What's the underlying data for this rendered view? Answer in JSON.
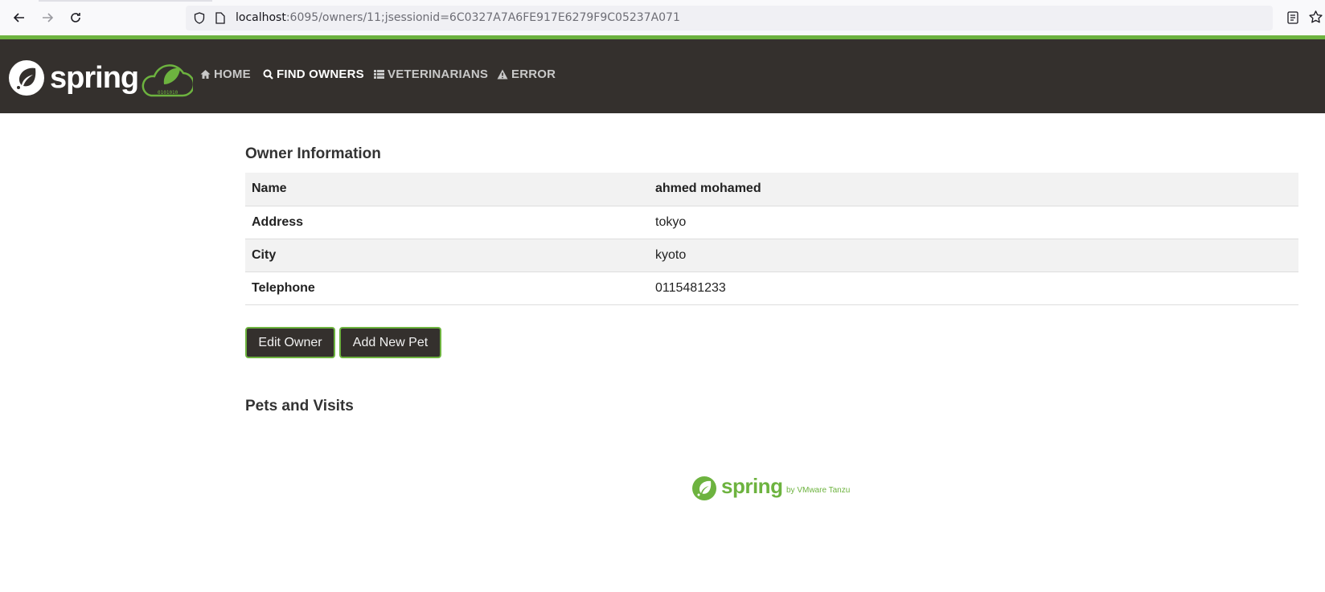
{
  "browser": {
    "url_host": "localhost",
    "url_rest": ":6095/owners/11;jsessionid=6C0327A7A6FE917E6279F9C05237A071"
  },
  "nav": {
    "brand_text": "spring",
    "items": [
      {
        "label": "HOME",
        "icon": "home-icon"
      },
      {
        "label": "FIND OWNERS",
        "icon": "search-icon",
        "active": true
      },
      {
        "label": "VETERINARIANS",
        "icon": "list-icon"
      },
      {
        "label": "ERROR",
        "icon": "warning-icon"
      }
    ]
  },
  "owner": {
    "heading": "Owner Information",
    "rows": [
      {
        "label": "Name",
        "value": "ahmed mohamed"
      },
      {
        "label": "Address",
        "value": "tokyo"
      },
      {
        "label": "City",
        "value": "kyoto"
      },
      {
        "label": "Telephone",
        "value": "0115481233"
      }
    ],
    "edit_button": "Edit Owner",
    "add_pet_button": "Add New Pet"
  },
  "pets": {
    "heading": "Pets and Visits"
  },
  "footer": {
    "brand_text": "spring",
    "by_text": "by VMware Tanzu"
  },
  "colors": {
    "spring_green": "#6db33f",
    "nav_dark": "#34302d"
  }
}
